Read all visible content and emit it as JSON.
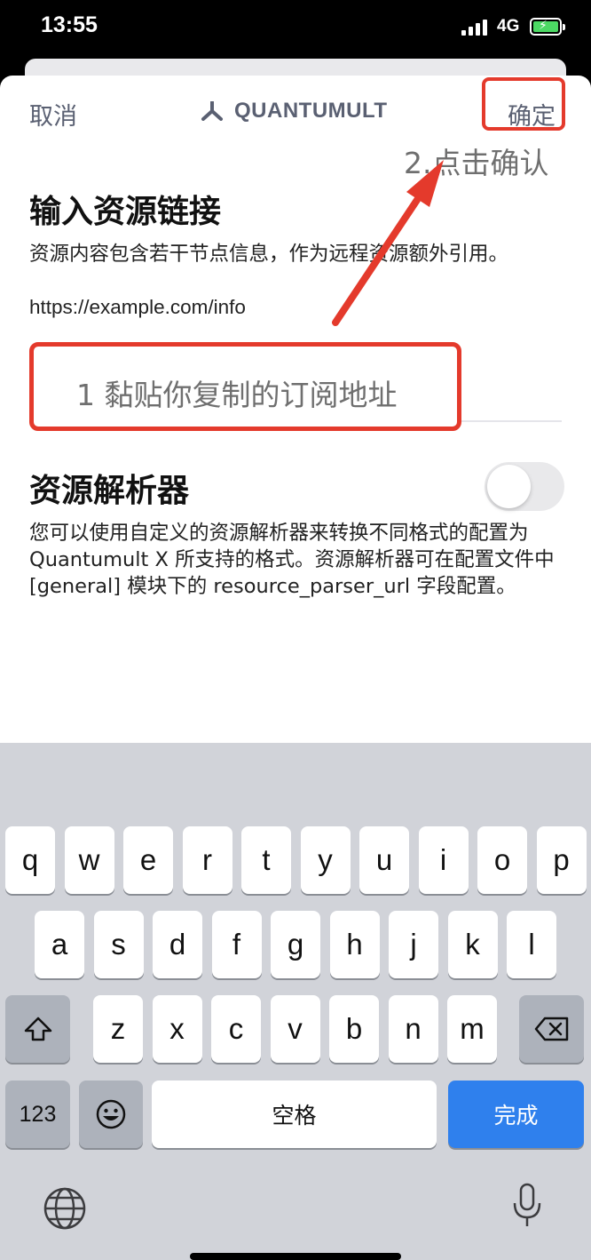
{
  "status": {
    "time": "13:55",
    "network": "4G"
  },
  "nav": {
    "cancel": "取消",
    "title": "QUANTUMULT",
    "confirm": "确定"
  },
  "annotations": {
    "step2": "2.点击确认",
    "step1": "1 黏贴你复制的订阅地址"
  },
  "resource": {
    "title": "输入资源链接",
    "description": "资源内容包含若干节点信息，作为远程资源额外引用。",
    "example": "https://example.com/info"
  },
  "parser": {
    "title": "资源解析器",
    "description": "您可以使用自定义的资源解析器来转换不同格式的配置为 Quantumult X 所支持的格式。资源解析器可在配置文件中 [general] 模块下的 resource_parser_url 字段配置。",
    "enabled": false
  },
  "keyboard": {
    "row1": [
      "q",
      "w",
      "e",
      "r",
      "t",
      "y",
      "u",
      "i",
      "o",
      "p"
    ],
    "row2": [
      "a",
      "s",
      "d",
      "f",
      "g",
      "h",
      "j",
      "k",
      "l"
    ],
    "row3": [
      "z",
      "x",
      "c",
      "v",
      "b",
      "n",
      "m"
    ],
    "numbers": "123",
    "space": "空格",
    "done": "完成",
    "icons": [
      "shift-icon",
      "delete-icon",
      "emoji-icon",
      "globe-icon",
      "mic-icon"
    ]
  },
  "colors": {
    "annotation_red": "#e43a2c",
    "done_blue": "#2f80ed",
    "toggle_off": "#e9e9eb"
  }
}
